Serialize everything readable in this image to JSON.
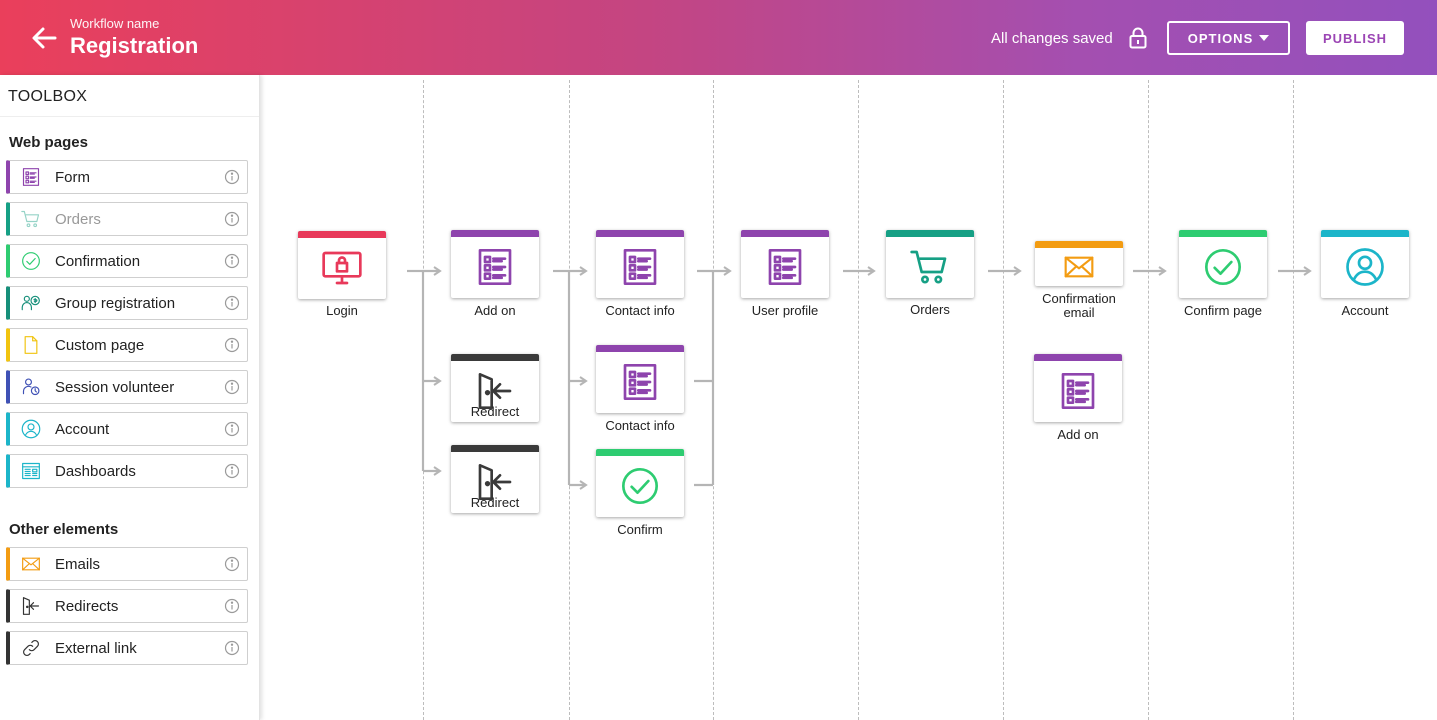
{
  "header": {
    "workflow_label": "Workflow name",
    "workflow_title": "Registration",
    "status": "All changes saved",
    "options_label": "OPTIONS",
    "publish_label": "PUBLISH"
  },
  "toolbox": {
    "title": "TOOLBOX",
    "web_pages_title": "Web pages",
    "web_pages": [
      {
        "label": "Form",
        "icon": "form-icon",
        "color": "#8e44ad"
      },
      {
        "label": "Orders",
        "icon": "cart-icon",
        "color": "#16a085",
        "disabled": true
      },
      {
        "label": "Confirmation",
        "icon": "check-circle-icon",
        "color": "#2ecc71"
      },
      {
        "label": "Group registration",
        "icon": "group-icon",
        "color": "#168f7a"
      },
      {
        "label": "Custom page",
        "icon": "page-icon",
        "color": "#f1c40f"
      },
      {
        "label": "Session volunteer",
        "icon": "volunteer-icon",
        "color": "#3f51b5"
      },
      {
        "label": "Account",
        "icon": "user-circle-icon",
        "color": "#1cb5c9"
      },
      {
        "label": "Dashboards",
        "icon": "dashboard-icon",
        "color": "#1cb5c9"
      }
    ],
    "other_title": "Other elements",
    "other": [
      {
        "label": "Emails",
        "icon": "envelope-icon",
        "color": "#f39c12"
      },
      {
        "label": "Redirects",
        "icon": "redirect-icon",
        "color": "#333333"
      },
      {
        "label": "External link",
        "icon": "link-icon",
        "color": "#333333"
      }
    ]
  },
  "flow": {
    "nodes": {
      "login": {
        "label": "Login",
        "color": "#e8395a"
      },
      "addon1": {
        "label": "Add on",
        "color": "#8e44ad"
      },
      "redirect1": {
        "label": "Redirect",
        "color": "#3a3a3a"
      },
      "redirect2": {
        "label": "Redirect",
        "color": "#3a3a3a"
      },
      "contact1": {
        "label": "Contact info",
        "color": "#8e44ad"
      },
      "contact2": {
        "label": "Contact info",
        "color": "#8e44ad"
      },
      "confirm": {
        "label": "Confirm",
        "color": "#2ecc71"
      },
      "userprofile": {
        "label": "User profile",
        "color": "#8e44ad"
      },
      "orders": {
        "label": "Orders",
        "color": "#16a085"
      },
      "confemail": {
        "label": "Confirmation email",
        "color": "#f39c12"
      },
      "addon2": {
        "label": "Add on",
        "color": "#8e44ad"
      },
      "confirmpage": {
        "label": "Confirm page",
        "color": "#2ecc71"
      },
      "account": {
        "label": "Account",
        "color": "#1cb5c9"
      }
    }
  }
}
